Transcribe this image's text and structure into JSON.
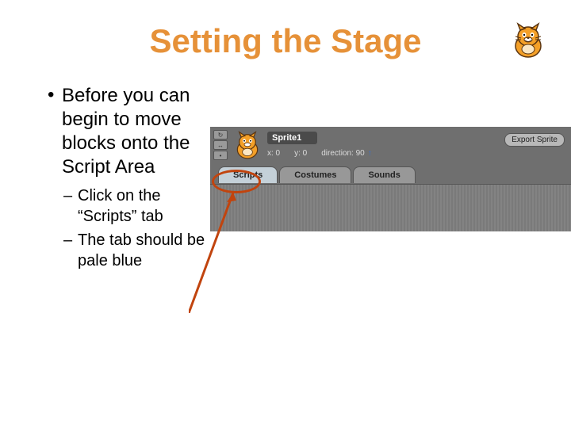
{
  "title": "Setting the Stage",
  "bullets": {
    "main": "Before you can begin to move blocks onto the Script Area",
    "sub1": "Click on the “Scripts” tab",
    "sub2": "The tab should be pale blue"
  },
  "scratch": {
    "sprite_name": "Sprite1",
    "x_label": "x: 0",
    "y_label": "y: 0",
    "direction_label": "direction: 90",
    "export_label": "Export Sprite",
    "tabs": {
      "scripts": "Scripts",
      "costumes": "Costumes",
      "sounds": "Sounds"
    }
  },
  "icons": {
    "cat": "scratch-cat"
  }
}
